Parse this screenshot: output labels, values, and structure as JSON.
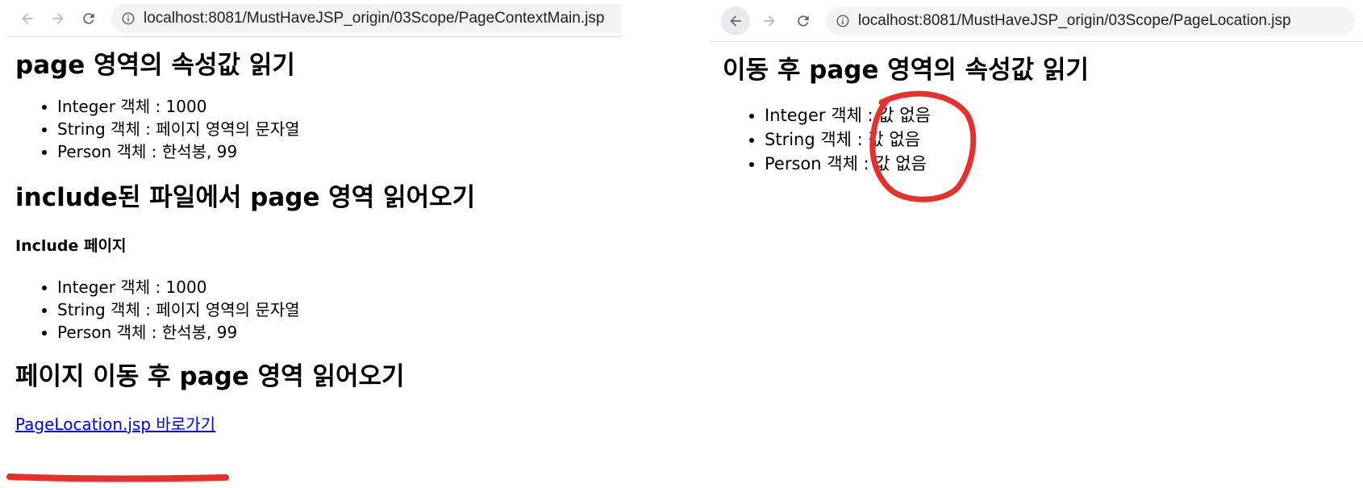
{
  "left_window": {
    "url": "localhost:8081/MustHaveJSP_origin/03Scope/PageContextMain.jsp",
    "heading_1": "page 영역의 속성값 읽기",
    "list_1": [
      "Integer 객체 : 1000",
      "String 객체 : 페이지 영역의 문자열",
      "Person 객체 : 한석봉, 99"
    ],
    "heading_2": "include된 파일에서 page 영역 읽어오기",
    "include_heading": "Include 페이지",
    "list_2": [
      "Integer 객체 : 1000",
      "String 객체 : 페이지 영역의 문자열",
      "Person 객체 : 한석봉, 99"
    ],
    "heading_3": "페이지 이동 후 page 영역 읽어오기",
    "link_text": "PageLocation.jsp 바로가기"
  },
  "right_window": {
    "url": "localhost:8081/MustHaveJSP_origin/03Scope/PageLocation.jsp",
    "heading": "이동 후 page 영역의 속성값 읽기",
    "list": [
      "Integer 객체 : 값 없음",
      "String 객체 : 값 없음",
      "Person 객체 : 값 없음"
    ]
  },
  "icons": {
    "back": "arrow-left-icon",
    "forward": "arrow-right-icon",
    "reload": "reload-icon",
    "site_info": "info-circle-icon"
  },
  "colors": {
    "annotation": "#e8302a",
    "link": "#0000ee",
    "omnibox": "#f1f3f4",
    "toolbar_icon_disabled": "#b6b6b6",
    "toolbar_icon": "#5f6368"
  }
}
